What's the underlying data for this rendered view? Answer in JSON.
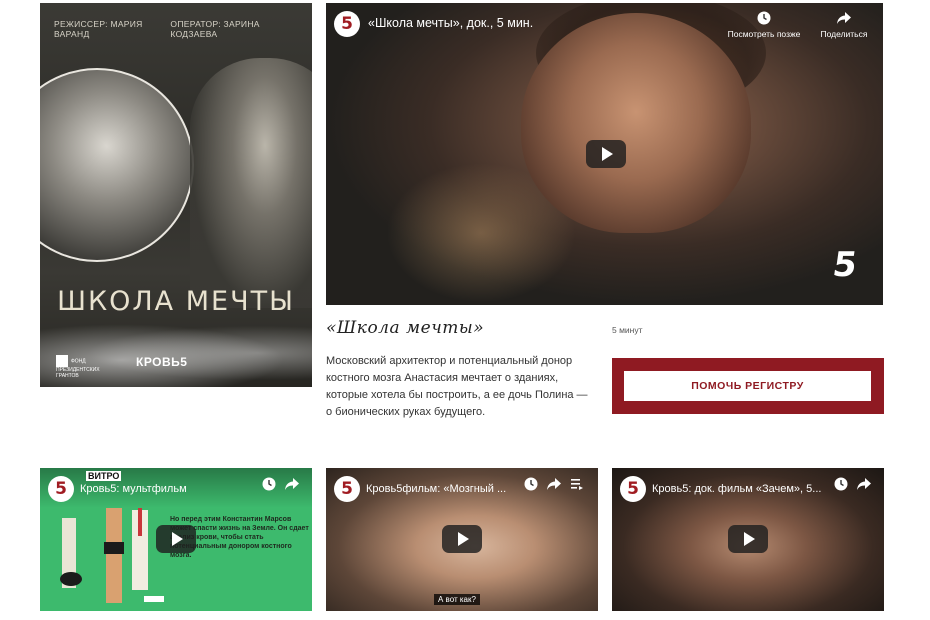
{
  "poster": {
    "director": "РЕЖИССЕР: МАРИЯ ВАРАНД",
    "operator": "ОПЕРАТОР: ЗАРИНА КОДЗАЕВА",
    "title": "ШКОЛА МЕЧТЫ",
    "fund_logo": "ФОНД ПРЕЗИДЕНТСКИХ ГРАНТОВ",
    "brand_logo": "КРОВЬ5"
  },
  "main_video": {
    "channel_logo": "5",
    "title": "«Школа мечты», док., 5 мин.",
    "watch_later": "Посмотреть позже",
    "share": "Поделиться",
    "brand_mark": "5"
  },
  "film": {
    "title": "«Школа мечты»",
    "duration": "5 минут",
    "description": "Московский архитектор и потенциальный донор костного мозга Анастасия мечтает о зданиях, которые хотела бы построить, а ее дочь Полина — о бионических руках будущего.",
    "help_button": "ПОМОЧЬ РЕГИСТРУ"
  },
  "videos": [
    {
      "channel_logo": "5",
      "title": "Кровь5: мультфильм",
      "overlay_text": "Но перед этим Константин Марсов может спасти жизнь на Земле. Он сдает анализ крови, чтобы стать потенциальным донором костного мозга.",
      "corner_label": "ВИТРО"
    },
    {
      "channel_logo": "5",
      "title": "Кровь5фильм: «Мозгный ...",
      "subtitle": "А вот как?"
    },
    {
      "channel_logo": "5",
      "title": "Кровь5: док. фильм «Зачем», 5..."
    }
  ],
  "colors": {
    "brand_red": "#8f1a22",
    "cartoon_green": "#3dba6d"
  }
}
